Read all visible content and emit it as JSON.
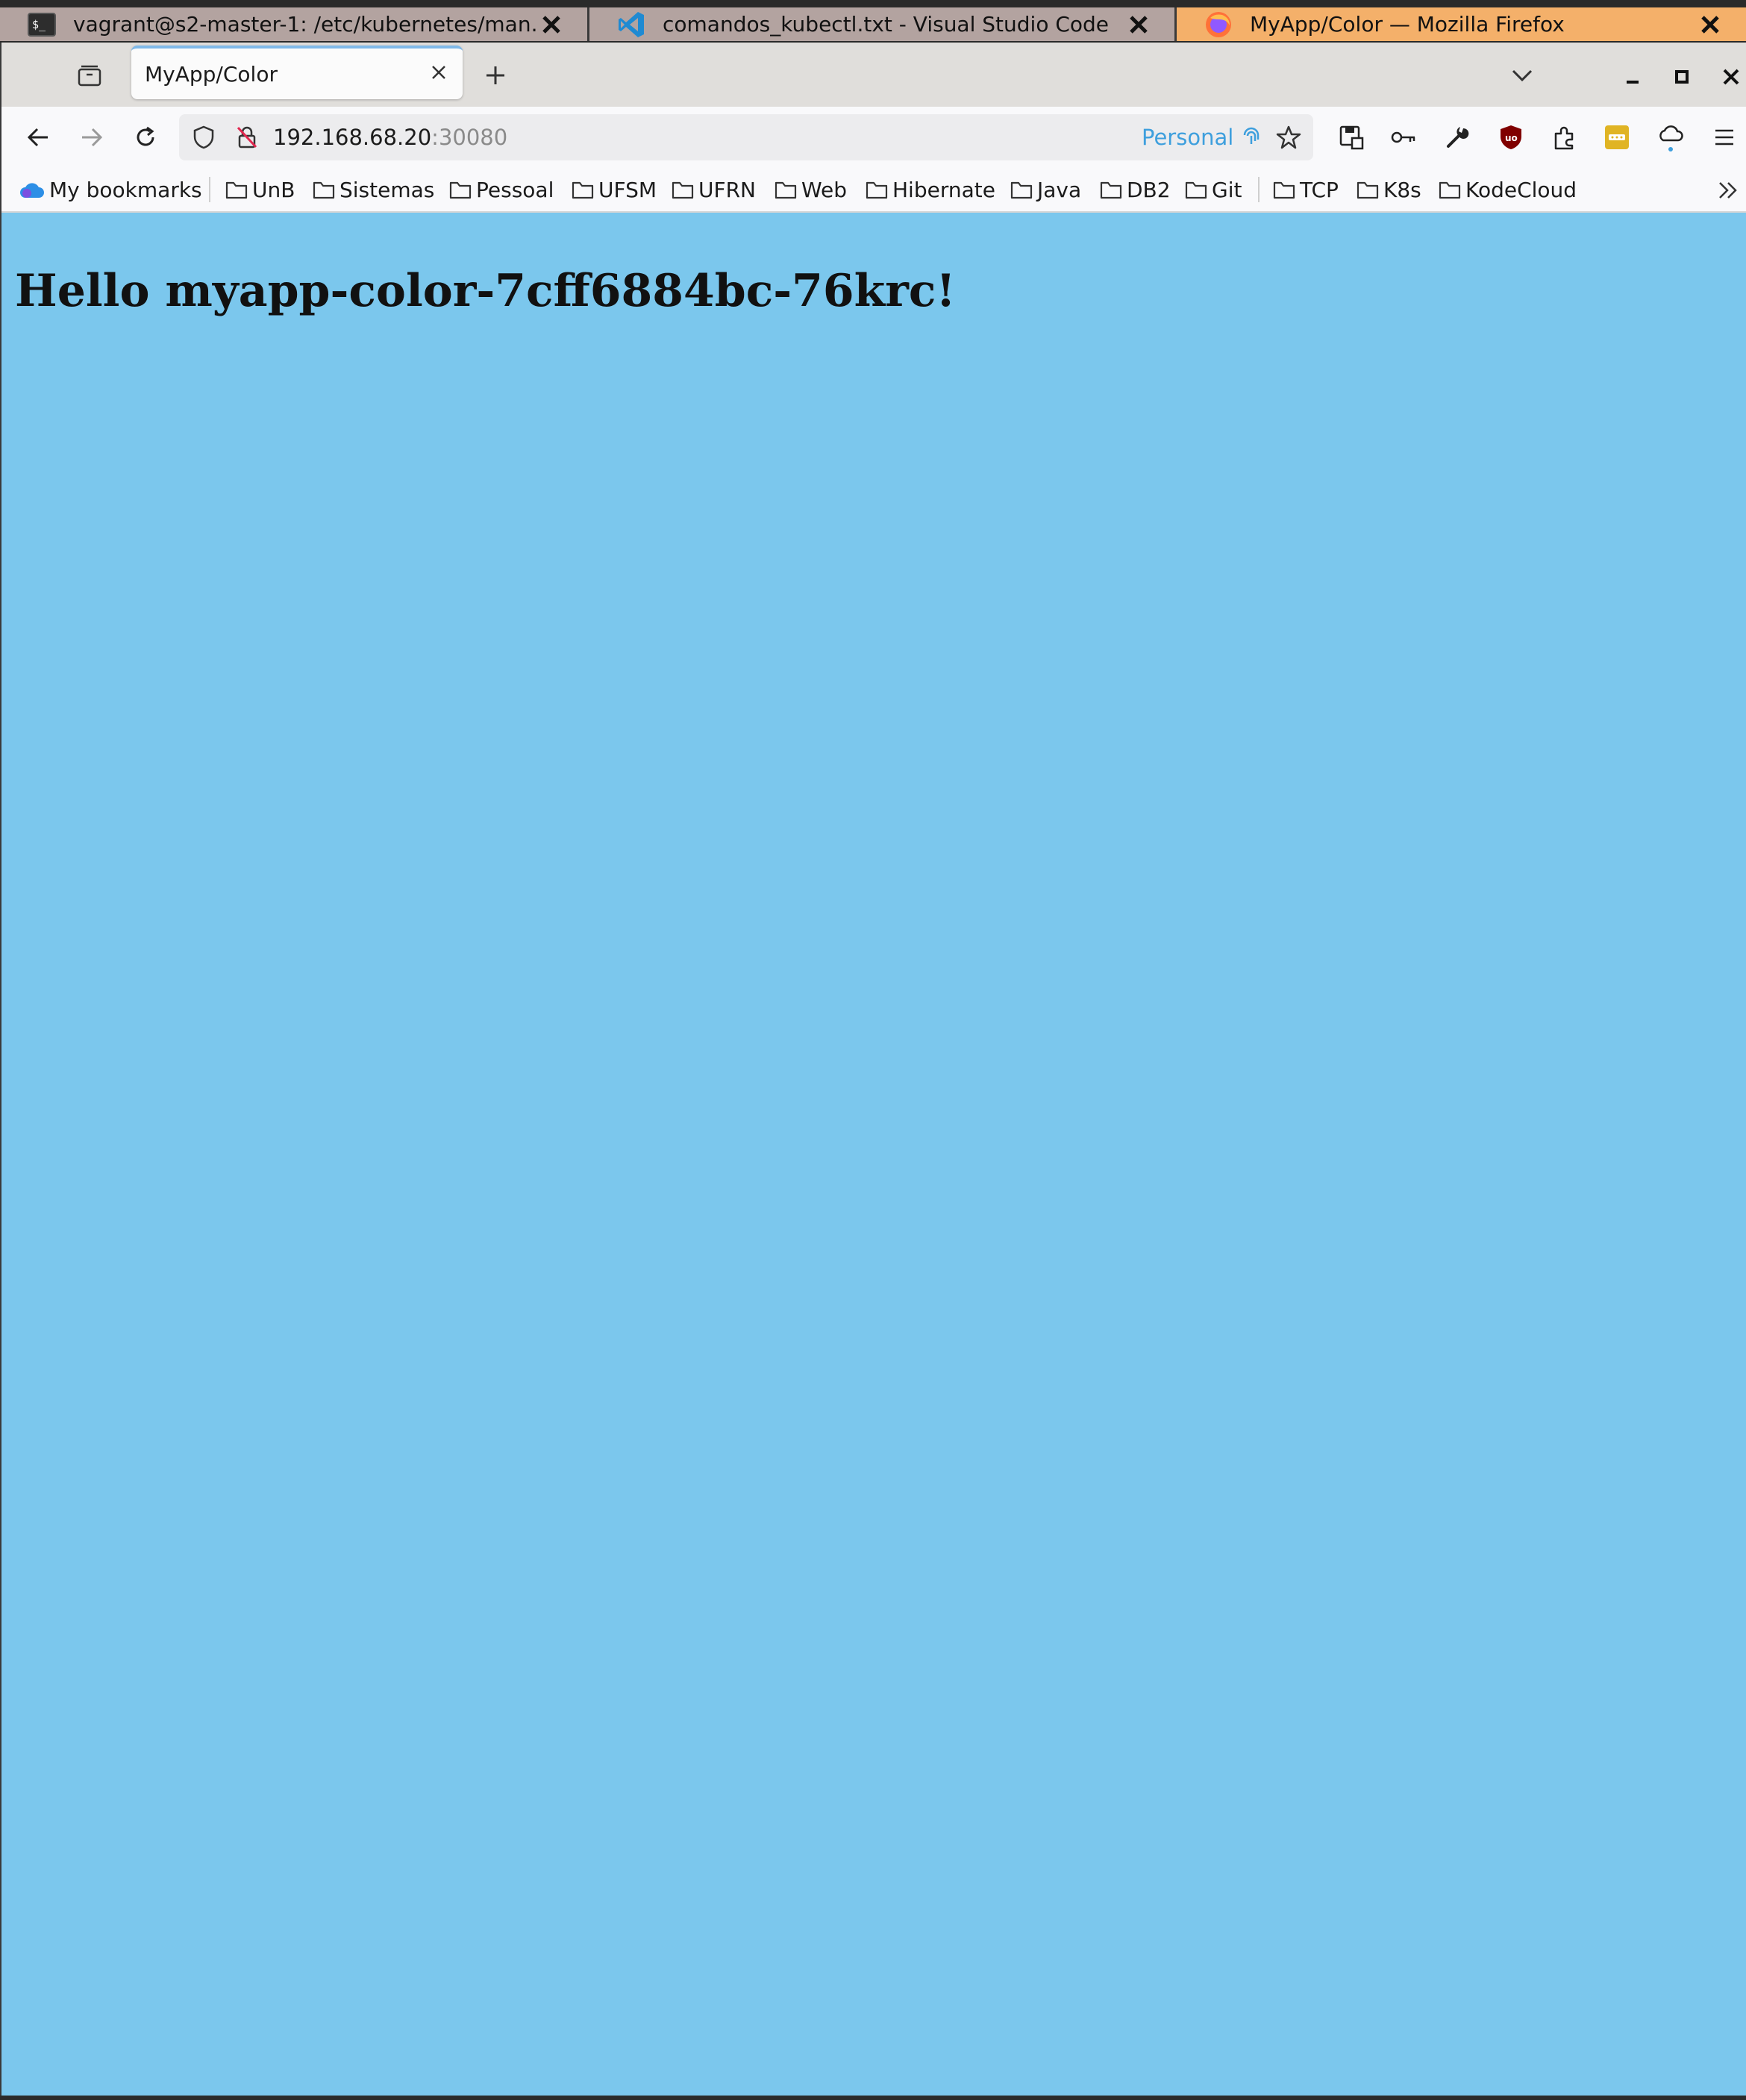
{
  "taskbar": {
    "tasks": [
      {
        "label": "vagrant@s2-master-1: /etc/kubernetes/man...",
        "icon": "terminal-icon"
      },
      {
        "label": "comandos_kubectl.txt - Visual Studio Code",
        "icon": "vscode-icon"
      },
      {
        "label": "MyApp/Color — Mozilla Firefox",
        "icon": "firefox-icon",
        "active": true
      }
    ]
  },
  "browser": {
    "tab_title": "MyApp/Color",
    "url_host": "192.168.68.20",
    "url_port": ":30080",
    "container_label": "Personal",
    "container_color": "#3e9fdd"
  },
  "bookmarks": [
    {
      "label": "My bookmarks",
      "icon": "cloud-icon"
    },
    {
      "label": "UnB",
      "icon": "folder-icon"
    },
    {
      "label": "Sistemas",
      "icon": "folder-icon"
    },
    {
      "label": "Pessoal",
      "icon": "folder-icon"
    },
    {
      "label": "UFSM",
      "icon": "folder-icon"
    },
    {
      "label": "UFRN",
      "icon": "folder-icon"
    },
    {
      "label": "Web",
      "icon": "folder-icon"
    },
    {
      "label": "Hibernate",
      "icon": "folder-icon"
    },
    {
      "label": "Java",
      "icon": "folder-icon"
    },
    {
      "label": "DB2",
      "icon": "folder-icon"
    },
    {
      "label": "Git",
      "icon": "folder-icon"
    },
    {
      "label": "TCP",
      "icon": "folder-icon"
    },
    {
      "label": "K8s",
      "icon": "folder-icon"
    },
    {
      "label": "KodeCloud",
      "icon": "folder-icon"
    }
  ],
  "page": {
    "heading": "Hello myapp-color-7cff6884bc-76krc!",
    "background_color": "#7bc7ed"
  }
}
